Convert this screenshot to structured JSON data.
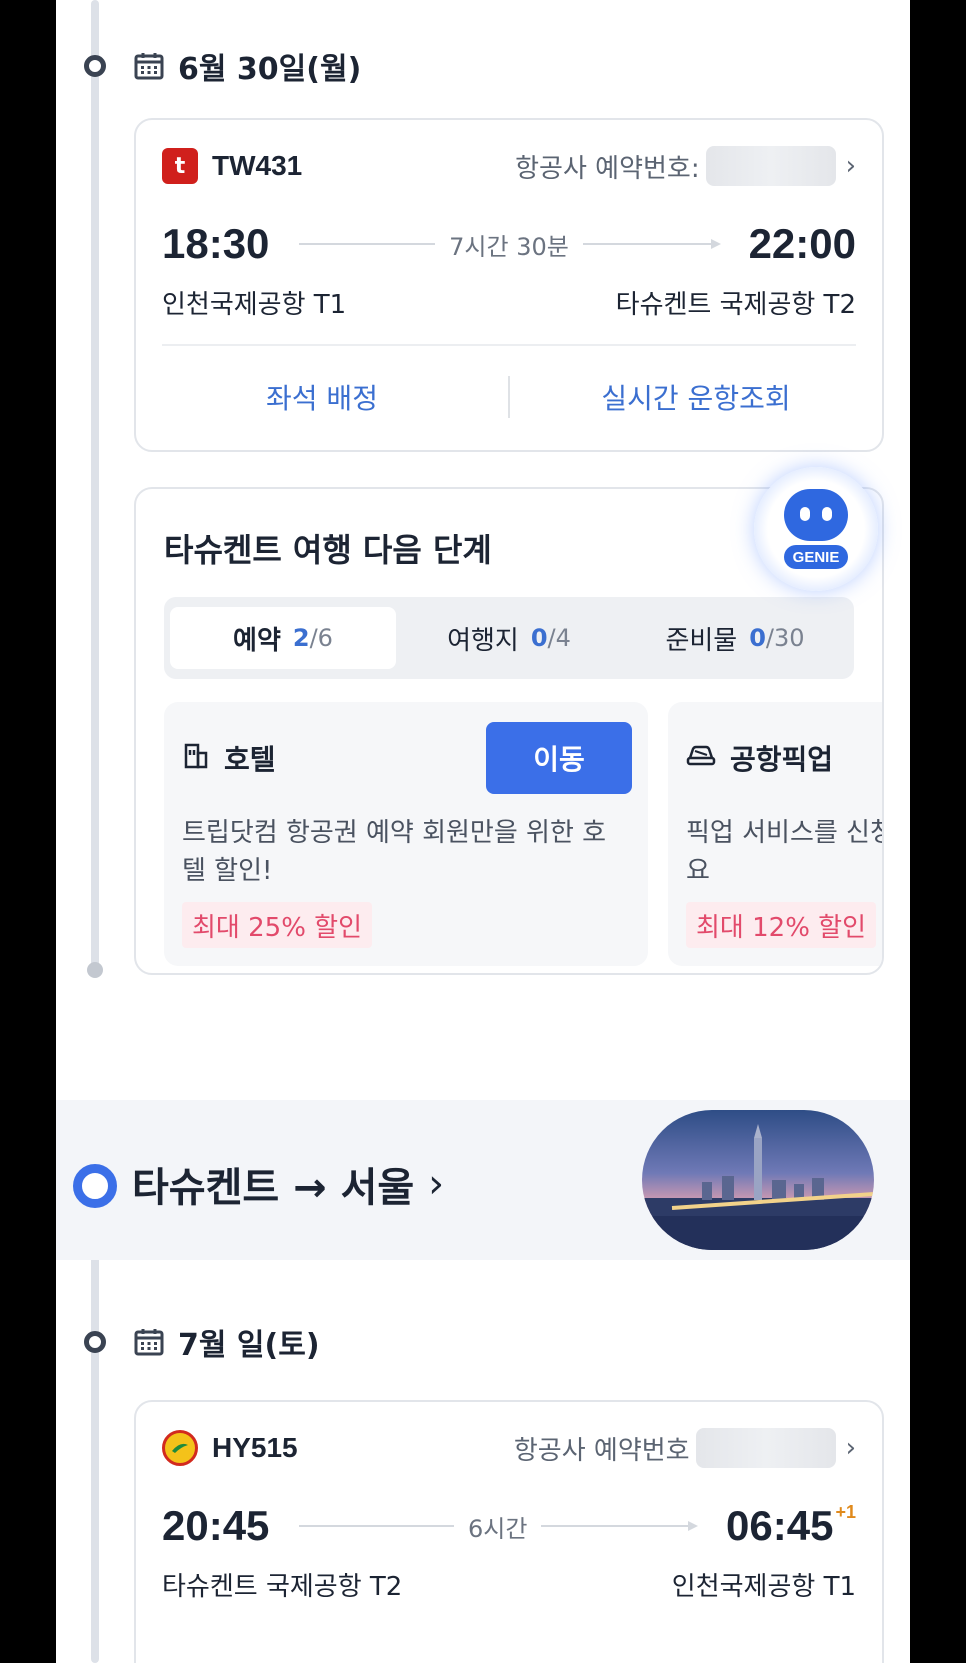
{
  "segment1": {
    "date": "6월 30일(월)",
    "flight": {
      "airline_logo_text": "t",
      "flight_no": "TW431",
      "booking_label": "항공사 예약번호: ",
      "dep_time": "18:30",
      "arr_time": "22:00",
      "duration": "7시간 30분",
      "dep_airport": "인천국제공항 T1",
      "arr_airport": "타슈켄트 국제공항 T2",
      "action_seat": "좌석 배정",
      "action_status": "실시간 운항조회"
    }
  },
  "genie": {
    "label": "GENIE"
  },
  "next_steps": {
    "title": "타슈켄트 여행 다음 단계",
    "tabs": [
      {
        "label": "예약",
        "done": "2",
        "total": "/6"
      },
      {
        "label": "여행지",
        "done": "0",
        "total": "/4"
      },
      {
        "label": "준비물",
        "done": "0",
        "total": "/30"
      }
    ],
    "promos": [
      {
        "title": "호텔",
        "button": "이동",
        "desc": "트립닷컴 항공권 예약 회원만을 위한 호텔 할인!",
        "badge": "최대 25% 할인"
      },
      {
        "title": "공항픽업",
        "desc": "픽업 서비스를 신청하고 편하게 도착하세요",
        "badge": "최대 12% 할인"
      }
    ]
  },
  "route": {
    "title": "타슈켄트 → 서울",
    "chevron": "›"
  },
  "segment2": {
    "date": "7월 일(토)",
    "flight": {
      "flight_no": "HY515",
      "booking_label": "항공사 예약번호",
      "dep_time": "20:45",
      "arr_time": "06:45",
      "arr_day_offset": "+1",
      "duration": "6시간",
      "dep_airport": "타슈켄트 국제공항 T2",
      "arr_airport": "인천국제공항 T1"
    }
  },
  "colors": {
    "accent": "#3b6fe8",
    "link": "#3b6fd0",
    "discount": "#e24a6b"
  }
}
